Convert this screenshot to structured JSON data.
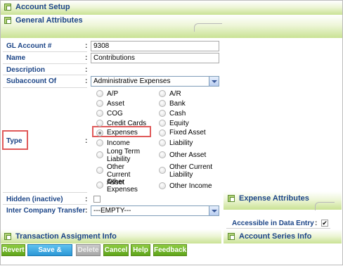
{
  "page": {
    "title": "Account Setup",
    "general_attributes": "General Attributes",
    "transaction_info": "Transaction Assigment Info"
  },
  "form": {
    "gl_account": {
      "label": "GL Account #",
      "value": "9308"
    },
    "name": {
      "label": "Name",
      "value": "Contributions"
    },
    "description": {
      "label": "Description",
      "value": ""
    },
    "subaccount": {
      "label": "Subaccount Of",
      "value": "Administrative Expenses"
    },
    "type": {
      "label": "Type",
      "selected": "Expenses",
      "options_left": [
        "A/P",
        "Asset",
        "COG",
        "Credit Cards",
        "Expenses",
        "Income",
        "Long Term Liability",
        "Other Current Asset",
        "Other Expenses"
      ],
      "options_right": [
        "A/R",
        "Bank",
        "Cash",
        "Equity",
        "Fixed Asset",
        "Liability",
        "Other Asset",
        "Other Current Liability",
        "Other Income"
      ]
    },
    "hidden": {
      "label": "Hidden (inactive)",
      "checked": false
    },
    "inter_company": {
      "label": "Inter Company Transfer",
      "value": "---EMPTY---"
    }
  },
  "expense_attributes": {
    "title": "Expense Attributes",
    "accessible_label": "Accessible in Data Entry",
    "accessible_checked": true,
    "check_mark": "✔",
    "series_title": "Account Series Info"
  },
  "buttons": {
    "revert": "Revert",
    "save_close": "Save & Close",
    "delete": "Delete",
    "cancel": "Cancel",
    "help": "Help",
    "feedback": "Feedback"
  },
  "colors": {
    "label_blue": "#1c4587",
    "highlight_red": "#e05a5a",
    "button_green": "#6bb126",
    "button_blue": "#2b97d6"
  }
}
